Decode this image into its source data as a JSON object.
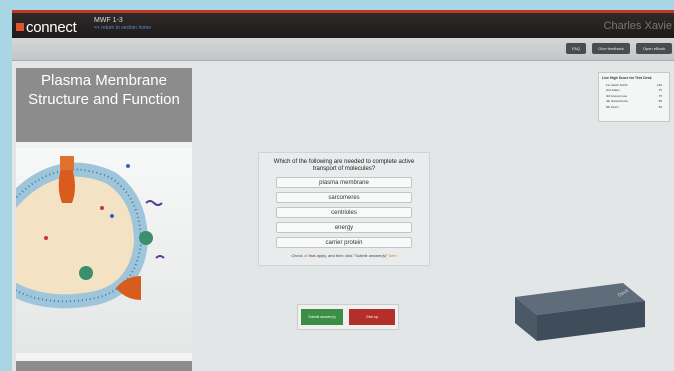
{
  "app": {
    "logo": "connect",
    "course_title": "MWF 1-3",
    "back_link": "<< return to section home",
    "user_name": "Charles Xavie"
  },
  "toolbar": {
    "buttons": [
      "FAQ",
      "Give feedback",
      "Open eBook"
    ]
  },
  "card": {
    "title": "Plasma Membrane Structure and Function"
  },
  "scores": {
    "title": "Live High Score for This Deck",
    "rows": [
      {
        "rank": "1st",
        "name": "Jacob Smith",
        "score": "140"
      },
      {
        "rank": "2nd",
        "name": "Adam",
        "score": "75"
      },
      {
        "rank": "3rd",
        "name": "Anonymous",
        "score": "75"
      },
      {
        "rank": "4th",
        "name": "Sonia Flores",
        "score": "50"
      },
      {
        "rank": "5th",
        "name": "Kevin",
        "score": "50"
      }
    ]
  },
  "question": {
    "text": "Which of the following are needed to complete active transport of molecules?",
    "options": [
      "plasma membrane",
      "sarcomeres",
      "centrioles",
      "energy",
      "carrier protein"
    ],
    "hint_prefix": "Check ",
    "hint_all": "all",
    "hint_middle": " that apply, and then click \"Submit answer(s)\"",
    "hint_link": "here"
  },
  "actions": {
    "submit": "Submit answer(s)",
    "give_up": "Give up"
  },
  "deck": {
    "label": "Deck"
  },
  "colors": {
    "accent_red": "#c2371f",
    "submit_green": "#3a8f45",
    "giveup_red": "#b3302a"
  }
}
